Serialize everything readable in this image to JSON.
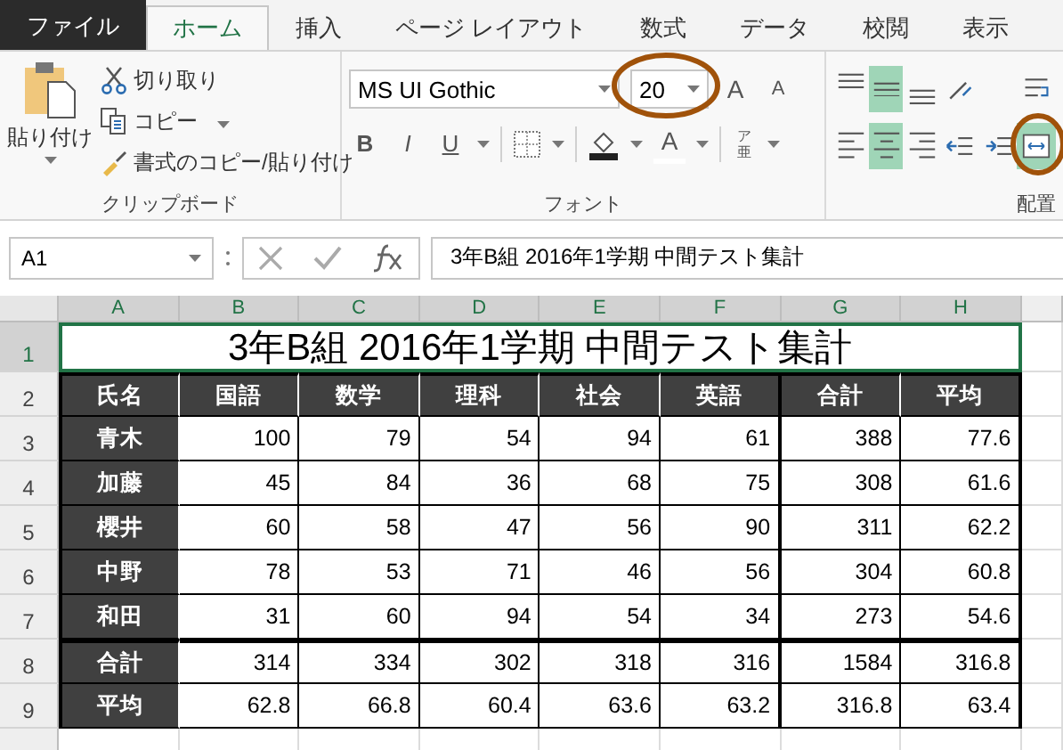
{
  "tabs": [
    {
      "label": "ファイル",
      "kind": "file",
      "selected": false
    },
    {
      "label": "ホーム",
      "kind": "tab",
      "selected": true
    },
    {
      "label": "挿入",
      "kind": "tab",
      "selected": false
    },
    {
      "label": "ページ レイアウト",
      "kind": "tab",
      "selected": false
    },
    {
      "label": "数式",
      "kind": "tab",
      "selected": false
    },
    {
      "label": "データ",
      "kind": "tab",
      "selected": false
    },
    {
      "label": "校閲",
      "kind": "tab",
      "selected": false
    },
    {
      "label": "表示",
      "kind": "tab",
      "selected": false
    }
  ],
  "clipboard": {
    "paste": "貼り付け",
    "cut": "切り取り",
    "copy": "コピー",
    "format_painter": "書式のコピー/貼り付け",
    "label": "クリップボード"
  },
  "font": {
    "name": "MS UI Gothic",
    "size": "20",
    "grow": "A",
    "shrink": "A",
    "bold": "B",
    "italic": "I",
    "underline": "U",
    "font_color": "A",
    "phonetic_top": "ア",
    "phonetic_bottom": "亜",
    "label": "フォント"
  },
  "alignment": {
    "label": "配置",
    "buttons": [
      {
        "kind": "top",
        "selected": false
      },
      {
        "kind": "middle",
        "selected": true
      },
      {
        "kind": "bottom",
        "selected": false
      },
      {
        "kind": "orientation",
        "selected": false
      },
      {
        "kind": "wrap",
        "selected": false
      },
      {
        "kind": "left",
        "selected": false
      },
      {
        "kind": "center",
        "selected": true
      },
      {
        "kind": "right",
        "selected": false
      },
      {
        "kind": "outdent",
        "selected": false
      },
      {
        "kind": "indent",
        "selected": false
      },
      {
        "kind": "merge",
        "selected": true
      }
    ]
  },
  "name_box": "A1",
  "formula": "3年B組 2016年1学期 中間テスト集計",
  "columns": [
    {
      "label": "A",
      "selected": true
    },
    {
      "label": "B",
      "selected": true
    },
    {
      "label": "C",
      "selected": true
    },
    {
      "label": "D",
      "selected": true
    },
    {
      "label": "E",
      "selected": true
    },
    {
      "label": "F",
      "selected": true
    },
    {
      "label": "G",
      "selected": true
    },
    {
      "label": "H",
      "selected": true
    }
  ],
  "title": {
    "row": "1",
    "text": "3年B組 2016年1学期 中間テスト集計",
    "selected": true
  },
  "rows": [
    {
      "row": "2",
      "kind": "header",
      "cells": [
        "氏名",
        "国語",
        "数学",
        "理科",
        "社会",
        "英語",
        "合計",
        "平均"
      ]
    },
    {
      "row": "3",
      "kind": "student",
      "cells": [
        "青木",
        "100",
        "79",
        "54",
        "94",
        "61",
        "388",
        "77.6"
      ]
    },
    {
      "row": "4",
      "kind": "student",
      "cells": [
        "加藤",
        "45",
        "84",
        "36",
        "68",
        "75",
        "308",
        "61.6"
      ]
    },
    {
      "row": "5",
      "kind": "student",
      "cells": [
        "櫻井",
        "60",
        "58",
        "47",
        "56",
        "90",
        "311",
        "62.2"
      ]
    },
    {
      "row": "6",
      "kind": "student",
      "cells": [
        "中野",
        "78",
        "53",
        "71",
        "46",
        "56",
        "304",
        "60.8"
      ]
    },
    {
      "row": "7",
      "kind": "student",
      "cells": [
        "和田",
        "31",
        "60",
        "94",
        "54",
        "34",
        "273",
        "54.6"
      ]
    },
    {
      "row": "8",
      "kind": "summary",
      "cells": [
        "合計",
        "314",
        "334",
        "302",
        "318",
        "316",
        "1584",
        "316.8"
      ]
    },
    {
      "row": "9",
      "kind": "summary",
      "cells": [
        "平均",
        "62.8",
        "66.8",
        "60.4",
        "63.6",
        "63.2",
        "316.8",
        "63.4"
      ]
    }
  ]
}
